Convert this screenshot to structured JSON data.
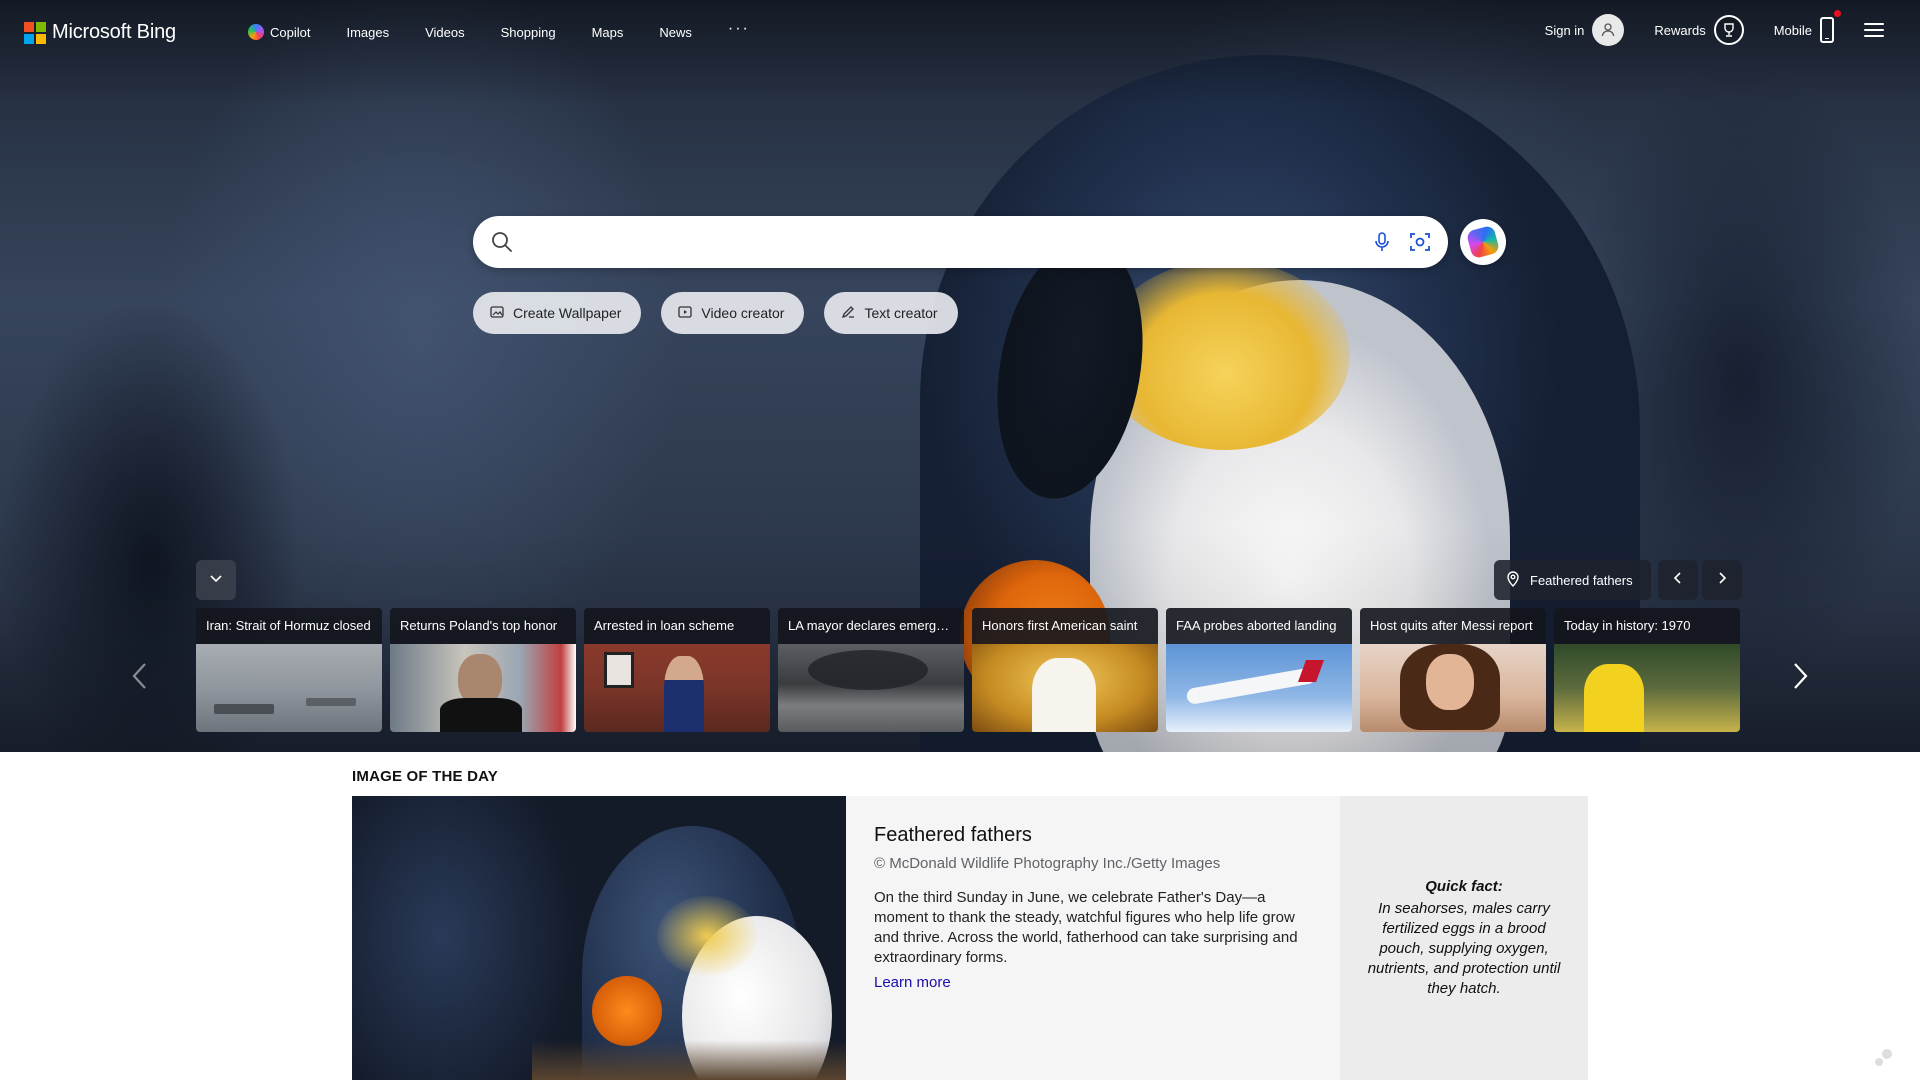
{
  "header": {
    "logo_text": "Microsoft Bing",
    "nav": [
      {
        "label": "Copilot",
        "icon": "copilot-icon"
      },
      {
        "label": "Images"
      },
      {
        "label": "Videos"
      },
      {
        "label": "Shopping"
      },
      {
        "label": "Maps"
      },
      {
        "label": "News"
      },
      {
        "label": "···"
      }
    ],
    "sign_in": "Sign in",
    "rewards": "Rewards",
    "mobile": "Mobile"
  },
  "search": {
    "value": "",
    "icons": [
      "search-icon",
      "microphone-icon",
      "visual-search-icon",
      "copilot-icon"
    ]
  },
  "chips": [
    {
      "label": "Create Wallpaper",
      "icon": "wallpaper-icon"
    },
    {
      "label": "Video creator",
      "icon": "video-creator-icon"
    },
    {
      "label": "Text creator",
      "icon": "text-creator-icon"
    }
  ],
  "carousel": {
    "location_label": "Feathered fathers",
    "cards": [
      {
        "title": "Iran: Strait of Hormuz closed"
      },
      {
        "title": "Returns Poland's top honor"
      },
      {
        "title": "Arrested in loan scheme"
      },
      {
        "title": "LA mayor declares emergency"
      },
      {
        "title": "Honors first American saint"
      },
      {
        "title": "FAA probes aborted landing"
      },
      {
        "title": "Host quits after Messi report"
      },
      {
        "title": "Today in history: 1970"
      }
    ]
  },
  "iotd": {
    "section_label": "IMAGE OF THE DAY",
    "title": "Feathered fathers",
    "credit": "© McDonald Wildlife Photography Inc./Getty Images",
    "description": "On the third Sunday in June, we celebrate Father's Day—a moment to thank the steady, watchful figures who help life grow and thrive. Across the world, fatherhood can take surprising and extraordinary forms.",
    "learn_more": "Learn more",
    "fact_label": "Quick fact:",
    "fact_text": "In seahorses, males carry fertilized eggs in a brood pouch, supplying oxygen, nutrients, and protection until they hatch."
  },
  "colors": {
    "ms_red": "#f25022",
    "ms_green": "#7fba00",
    "ms_blue": "#00a4ef",
    "ms_yellow": "#ffb900",
    "link": "#1a0dab",
    "notification": "#e81123"
  }
}
